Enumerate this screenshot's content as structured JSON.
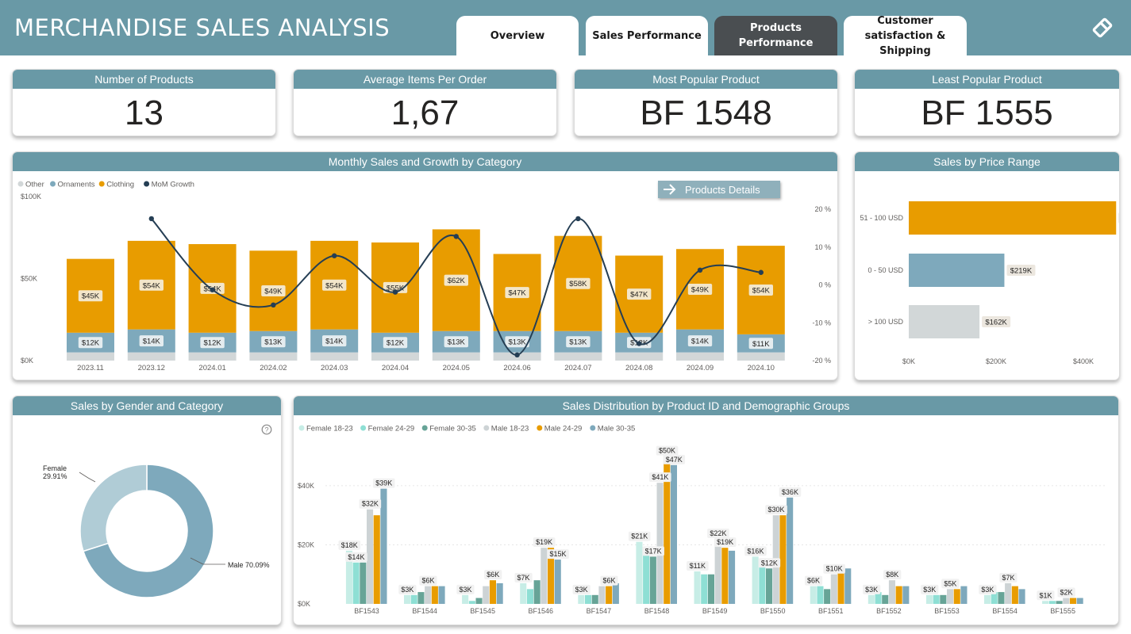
{
  "app": {
    "title": "MERCHANDISE SALES ANALYSIS",
    "logo_icon": "diamond-logo-icon"
  },
  "tabs": [
    {
      "label": "Overview",
      "active": false
    },
    {
      "label": "Sales Performance",
      "active": false
    },
    {
      "label": "Products Performance",
      "active": true
    },
    {
      "label": "Customer satisfaction & Shipping",
      "active": false
    }
  ],
  "kpis": [
    {
      "title": "Number of Products",
      "value": "13"
    },
    {
      "title": "Average Items Per Order",
      "value": "1,67"
    },
    {
      "title": "Most Popular Product",
      "value": "BF 1548"
    },
    {
      "title": "Least Popular Product",
      "value": "BF 1555"
    }
  ],
  "colors": {
    "header": "#6999a6",
    "other": "#d2d7d8",
    "ornaments": "#7ea9bc",
    "clothing": "#e89c00",
    "growth": "#253e54",
    "tab_active": "#4a4e51"
  },
  "monthly": {
    "title": "Monthly Sales and Growth by Category",
    "button_label": "Products Details",
    "chart_data": {
      "type": "bar",
      "categories": [
        "2023.11",
        "2023.12",
        "2024.01",
        "2024.02",
        "2024.03",
        "2024.04",
        "2024.05",
        "2024.06",
        "2024.07",
        "2024.08",
        "2024.09",
        "2024.10"
      ],
      "series": [
        {
          "name": "Other",
          "values": [
            5,
            5,
            5,
            5,
            5,
            5,
            5,
            5,
            5,
            5,
            5,
            5
          ]
        },
        {
          "name": "Ornaments",
          "values": [
            12,
            14,
            12,
            13,
            14,
            12,
            13,
            13,
            13,
            12,
            14,
            11
          ]
        },
        {
          "name": "Clothing",
          "values": [
            45,
            54,
            54,
            49,
            54,
            55,
            62,
            47,
            58,
            47,
            49,
            54
          ]
        },
        {
          "name": "MoM Growth",
          "values": [
            17.5,
            -1.3,
            -5.3,
            7.7,
            -1.9,
            12.8,
            -18.5,
            17.5,
            -15.5,
            3.9,
            3.3
          ]
        }
      ],
      "bar_labels": {
        "Ornaments": [
          "$12K",
          "$14K",
          "$12K",
          "$13K",
          "$14K",
          "$12K",
          "$13K",
          "$13K",
          "$13K",
          "$12K",
          "$14K",
          "$11K"
        ],
        "Clothing": [
          "$45K",
          "$54K",
          "$54K",
          "$49K",
          "$54K",
          "$55K",
          "$62K",
          "$47K",
          "$58K",
          "$47K",
          "$49K",
          "$54K"
        ]
      },
      "growth_x_index": [
        1,
        2,
        3,
        4,
        5,
        6,
        7,
        8,
        9,
        10,
        11
      ],
      "y_ticks": [
        "$0K",
        "$50K",
        "$100K"
      ],
      "y2_ticks": [
        "-20 %",
        "-10 %",
        "0 %",
        "10 %",
        "20 %"
      ],
      "ylim": [
        0,
        100
      ],
      "y2lim": [
        -20,
        20
      ],
      "legend": [
        "Other",
        "Ornaments",
        "Clothing",
        "MoM Growth"
      ],
      "legend_placement": "top-left"
    }
  },
  "price_range": {
    "title": "Sales by Price Range",
    "chart_data": {
      "type": "bar",
      "orientation": "horizontal",
      "categories": [
        "51 - 100 USD",
        "0 - 50 USD",
        "> 100 USD"
      ],
      "values": [
        475,
        219,
        162
      ],
      "labels": [
        "$475K",
        "$219K",
        "$162K"
      ],
      "x_ticks": [
        "$0K",
        "$200K",
        "$400K"
      ],
      "xlim": [
        0,
        500
      ],
      "bar_colors": [
        "#e89c00",
        "#7ea9bc",
        "#d2d7d8"
      ]
    }
  },
  "gender": {
    "title": "Sales by Gender and Category",
    "help_icon": "question-icon",
    "chart_data": {
      "type": "pie",
      "donut": true,
      "slices": [
        {
          "label": "Female",
          "pct_label": "29.91%",
          "value": 29.91,
          "color": "#b0ccd6"
        },
        {
          "label": "Male",
          "pct_label": "70.09%",
          "value": 70.09,
          "color": "#7ea9bc"
        }
      ]
    }
  },
  "distribution": {
    "title": "Sales Distribution by Product ID and Demographic Groups",
    "chart_data": {
      "type": "bar",
      "categories": [
        "BF1543",
        "BF1544",
        "BF1545",
        "BF1546",
        "BF1547",
        "BF1548",
        "BF1549",
        "BF1550",
        "BF1551",
        "BF1552",
        "BF1553",
        "BF1554",
        "BF1555"
      ],
      "series": [
        {
          "name": "Female 18-23",
          "color": "#c7ede6",
          "values": [
            18,
            3,
            3,
            7,
            3,
            21,
            11,
            16,
            6,
            3,
            3,
            3,
            1
          ]
        },
        {
          "name": "Female 24-29",
          "color": "#8edfd4",
          "values": [
            14,
            3,
            1,
            5,
            3,
            17,
            10,
            15,
            6,
            4,
            3,
            4,
            1
          ]
        },
        {
          "name": "Female 30-35",
          "color": "#67a497",
          "values": [
            14,
            4,
            2,
            8,
            3,
            16,
            10,
            12,
            5,
            3,
            3,
            4,
            1
          ]
        },
        {
          "name": "Male 18-23",
          "color": "#cdd3d5",
          "values": [
            32,
            6,
            6,
            19,
            6,
            41,
            22,
            30,
            10,
            8,
            5,
            7,
            2
          ]
        },
        {
          "name": "Male 24-29",
          "color": "#e89c00",
          "values": [
            30,
            6,
            8,
            19,
            6,
            50,
            19,
            30,
            11,
            6,
            5,
            6,
            2
          ]
        },
        {
          "name": "Male 30-35",
          "color": "#7ea9bc",
          "values": [
            39,
            6,
            7,
            15,
            7,
            47,
            18,
            36,
            12,
            6,
            6,
            5,
            2
          ]
        }
      ],
      "point_labels": [
        {
          "category": 0,
          "series": 0,
          "text": "$18K"
        },
        {
          "category": 0,
          "series": 1,
          "text": "$14K"
        },
        {
          "category": 0,
          "series": 3,
          "text": "$32K"
        },
        {
          "category": 0,
          "series": 5,
          "text": "$39K"
        },
        {
          "category": 1,
          "series": 0,
          "text": "$3K"
        },
        {
          "category": 1,
          "series": 3,
          "text": "$6K"
        },
        {
          "category": 2,
          "series": 0,
          "text": "$3K"
        },
        {
          "category": 2,
          "series": 4,
          "text": "$6K"
        },
        {
          "category": 3,
          "series": 0,
          "text": "$7K"
        },
        {
          "category": 3,
          "series": 3,
          "text": "$19K"
        },
        {
          "category": 3,
          "series": 5,
          "text": "$15K"
        },
        {
          "category": 4,
          "series": 0,
          "text": "$3K"
        },
        {
          "category": 4,
          "series": 4,
          "text": "$6K"
        },
        {
          "category": 5,
          "series": 0,
          "text": "$21K"
        },
        {
          "category": 5,
          "series": 2,
          "text": "$17K"
        },
        {
          "category": 5,
          "series": 3,
          "text": "$41K"
        },
        {
          "category": 5,
          "series": 4,
          "text": "$50K"
        },
        {
          "category": 5,
          "series": 5,
          "text": "$47K"
        },
        {
          "category": 6,
          "series": 0,
          "text": "$11K"
        },
        {
          "category": 6,
          "series": 3,
          "text": "$22K"
        },
        {
          "category": 6,
          "series": 4,
          "text": "$19K"
        },
        {
          "category": 7,
          "series": 0,
          "text": "$16K"
        },
        {
          "category": 7,
          "series": 2,
          "text": "$12K"
        },
        {
          "category": 7,
          "series": 3,
          "text": "$30K"
        },
        {
          "category": 7,
          "series": 5,
          "text": "$36K"
        },
        {
          "category": 8,
          "series": 0,
          "text": "$6K"
        },
        {
          "category": 8,
          "series": 3,
          "text": "$10K"
        },
        {
          "category": 9,
          "series": 0,
          "text": "$3K"
        },
        {
          "category": 9,
          "series": 3,
          "text": "$8K"
        },
        {
          "category": 10,
          "series": 0,
          "text": "$3K"
        },
        {
          "category": 10,
          "series": 3,
          "text": "$5K"
        },
        {
          "category": 11,
          "series": 0,
          "text": "$3K"
        },
        {
          "category": 11,
          "series": 3,
          "text": "$7K"
        },
        {
          "category": 12,
          "series": 0,
          "text": "$1K"
        },
        {
          "category": 12,
          "series": 3,
          "text": "$2K"
        }
      ],
      "y_ticks": [
        "$0K",
        "$20K",
        "$40K"
      ],
      "ylim": [
        0,
        55
      ],
      "legend_placement": "top-left"
    }
  }
}
